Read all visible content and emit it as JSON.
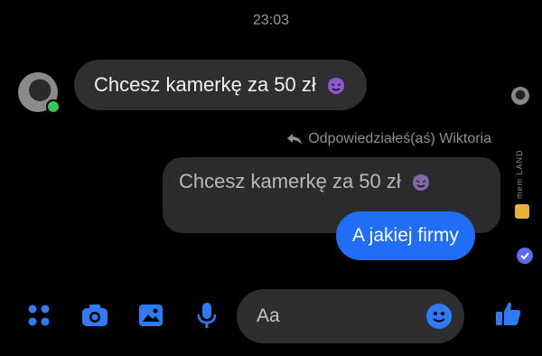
{
  "chat": {
    "timestamp": "23:03",
    "incoming_message": "Chcesz kamerkę za 50 zł",
    "reply_context": "Odpowiedziałeś(aś) Wiktoria",
    "quoted_message": "Chcesz kamerkę za 50 zł",
    "outgoing_message": "A jakiej firmy"
  },
  "composer": {
    "placeholder": "Aa"
  },
  "watermark": {
    "text": "mem LAND"
  },
  "icons": [
    "apps-icon",
    "camera-icon",
    "image-icon",
    "microphone-icon",
    "emoji-icon",
    "like-icon",
    "devil-emoji-icon",
    "reply-arrow-icon",
    "seen-indicator-icon"
  ],
  "colors": {
    "background": "#000000",
    "incoming_bubble": "#2f2f31",
    "outgoing_bubble": "#1f6ef5",
    "accent": "#2f7bf6"
  }
}
